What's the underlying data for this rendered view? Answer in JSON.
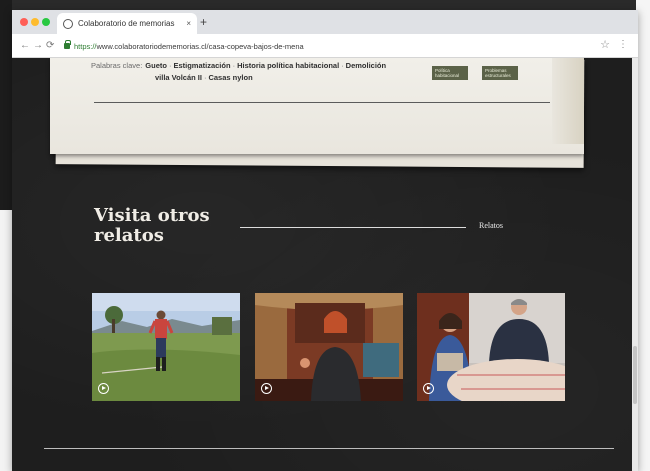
{
  "browser": {
    "tab_title": "Colaboratorio de memorias",
    "tab_close": "×",
    "new_tab": "+",
    "url_scheme": "https://",
    "url_rest": "www.colaboratoriodememorias.cl/casa-copeva-bajos-de-mena",
    "back_glyph": "←",
    "forward_glyph": "→",
    "reload_glyph": "⟳",
    "star_glyph": "☆",
    "menu_glyph": "⋮"
  },
  "keywords": {
    "label": "Palabras clave:",
    "line1": [
      "Gueto",
      "Estigmatización",
      "Historia política habitacional",
      "Demolición"
    ],
    "line2": [
      "villa Volcán II",
      "Casas nylon"
    ],
    "separator": "·"
  },
  "badges": [
    {
      "text": "Política habitacional"
    },
    {
      "text": "Problemas estructurales"
    }
  ],
  "section": {
    "title": "Visita otros relatos",
    "link": "Relatos"
  },
  "cards": [
    {
      "scene": "woman-standing-field",
      "icon": "play-icon"
    },
    {
      "scene": "woman-interview-curtains",
      "icon": "play-icon"
    },
    {
      "scene": "couple-sitting-table",
      "icon": "play-icon"
    }
  ],
  "colors": {
    "page_background": "#1e1e1e",
    "paper": "#f1efe9",
    "badge": "#5b6248",
    "heading": "#f0ede6"
  }
}
